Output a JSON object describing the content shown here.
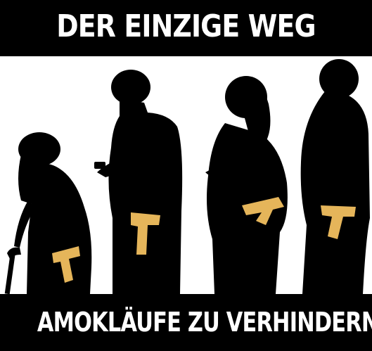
{
  "captions": {
    "top": "DER EINZIGE WEG",
    "bottom": "AMOKLÄUFE ZU VERHINDERN"
  },
  "colors": {
    "background": "#ffffff",
    "silhouette": "#000000",
    "gun": "#e5b55a",
    "caption_band": "#000000",
    "caption_text": "#ffffff"
  },
  "figures": [
    {
      "name": "elderly-woman-with-cane",
      "gun": "holstered-at-hip"
    },
    {
      "name": "man-with-phone",
      "gun": "holstered-at-hip"
    },
    {
      "name": "woman-with-crossed-arms",
      "gun": "tucked-at-waist"
    },
    {
      "name": "man-with-crossed-arms",
      "gun": "holstered-at-hip"
    }
  ]
}
